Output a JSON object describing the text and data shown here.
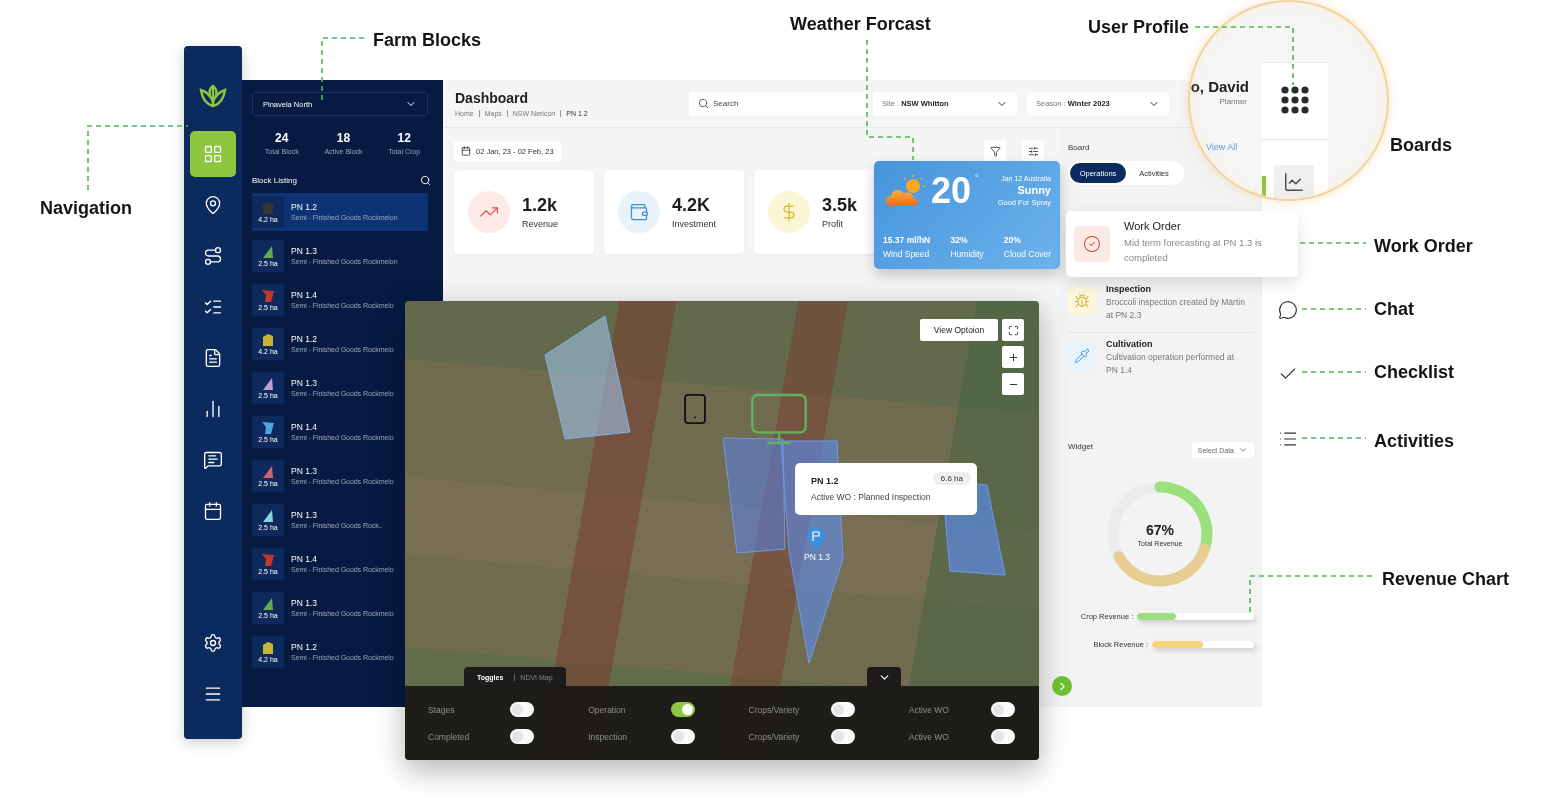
{
  "callouts": [
    {
      "label": "Farm Blocks"
    },
    {
      "label": "Weather Forcast"
    },
    {
      "label": "User Profile"
    },
    {
      "label": "Navigation"
    },
    {
      "label": "Boards"
    },
    {
      "label": "Work Order"
    },
    {
      "label": "Chat"
    },
    {
      "label": "Checklist"
    },
    {
      "label": "Activities"
    },
    {
      "label": "Revenue Chart"
    }
  ],
  "nav": {
    "items": [
      {
        "selected": true
      },
      {
        "selected": false
      },
      {
        "selected": false
      },
      {
        "selected": false
      },
      {
        "selected": false
      },
      {
        "selected": false
      },
      {
        "selected": false
      },
      {
        "selected": false
      }
    ]
  },
  "blocks": {
    "farm": "Pinavela North",
    "stats": [
      {
        "value": "24",
        "label": "Total Block"
      },
      {
        "value": "18",
        "label": "Active Block"
      },
      {
        "value": "12",
        "label": "Total Crop"
      }
    ],
    "title": "Block Listing",
    "items": [
      {
        "name": "PN 1.2",
        "description": "Semi - Finished Goods Rockmelon",
        "area": "4.2 ha",
        "kind": "house",
        "color": "#3a3535",
        "selected": true
      },
      {
        "name": "PN 1.3",
        "description": "Semi - Finished Goods Rockmelon",
        "area": "2.5 ha",
        "kind": "triangle",
        "color": "#6aa84f",
        "selected": false
      },
      {
        "name": "PN 1.4",
        "description": "Semi - Finished Goods Rockmelo",
        "area": "2.5 ha",
        "kind": "slant",
        "color": "#c0392b",
        "selected": false
      },
      {
        "name": "PN 1.2",
        "description": "Semi - Finished Goods Rockmelo",
        "area": "4.2 ha",
        "kind": "house",
        "color": "#c9b43a",
        "selected": false
      },
      {
        "name": "PN 1.3",
        "description": "Semi - Finished Goods Rockmelo",
        "area": "2.5 ha",
        "kind": "triangle",
        "color": "#c79bd4",
        "selected": false
      },
      {
        "name": "PN 1.4",
        "description": "Semi - Finished Goods Rockmelo",
        "area": "2.5 ha",
        "kind": "slant",
        "color": "#4aa3df",
        "selected": false
      },
      {
        "name": "PN 1.3",
        "description": "Semi - Finished Goods Rockmelo",
        "area": "2.5 ha",
        "kind": "triangle",
        "color": "#d0636f",
        "selected": false
      },
      {
        "name": "PN 1.3",
        "description": "Semi - Finished Goods Rock..",
        "area": "2.5 ha",
        "kind": "triangle",
        "color": "#8fd0e0",
        "selected": false
      },
      {
        "name": "PN 1.4",
        "description": "Semi - Finished Goods Rockmelo",
        "area": "2.5 ha",
        "kind": "slant",
        "color": "#c0392b",
        "selected": false
      },
      {
        "name": "PN 1.3",
        "description": "Semi - Finished Goods Rockmelo",
        "area": "2.5 ha",
        "kind": "triangle",
        "color": "#6aa84f",
        "selected": false
      },
      {
        "name": "PN 1.2",
        "description": "Semi - Finished Goods Rockmelo",
        "area": "4.2 ha",
        "kind": "house",
        "color": "#c9b43a",
        "selected": false
      }
    ]
  },
  "header": {
    "title": "Dashboard",
    "breadcrumb": [
      "Home",
      "Maps",
      "NSW Nericon",
      "PN 1.2"
    ],
    "search": {
      "placeholder": "Search"
    },
    "site": "Site : **NSW Whitton**",
    "season": "Season : **Winter 2023**"
  },
  "date_range": "02 Jan, 23 - 02 Feb, 23",
  "stats": [
    {
      "value": "1.2k",
      "label": "Revenue"
    },
    {
      "value": "4.2K",
      "label": "Investment"
    },
    {
      "value": "3.5k",
      "label": "Profit"
    }
  ],
  "weather": {
    "temperature": "20",
    "unit": "°",
    "date": "Jan 12 Australia",
    "condition": "Sunny",
    "advice": "Good For Spray",
    "metrics": [
      {
        "value": "15.37 ml/hN",
        "label": "Wind Speed"
      },
      {
        "value": "32%",
        "label": "Humidity"
      },
      {
        "value": "20%",
        "label": "Cloud Cover"
      }
    ]
  },
  "profile": {
    "name": "o, David",
    "role": "Planner",
    "link": "View All"
  },
  "board": {
    "title": "Board",
    "tabs": [
      {
        "label": "Operations",
        "selected": true
      },
      {
        "label": "Activities",
        "selected": false
      }
    ],
    "items": [
      {
        "title": "Inspection",
        "text": "Broccoli inspection created by Martin at PN 2.3"
      },
      {
        "title": "Cultivation",
        "text": "Cultivation operation performed at PN 1.4"
      }
    ]
  },
  "work_order": {
    "title": "Work Order",
    "text": "Mid term forecasting at PN 1.3 is completed"
  },
  "widget": {
    "title": "Widget",
    "select": "Select Data",
    "donut": {
      "value": "67%",
      "label": "Total Revenue"
    },
    "bars": [
      {
        "label": "Crop Revenue :",
        "level": 0.33,
        "color": "#9be07e"
      },
      {
        "label": "Block Revenue :",
        "level": 0.5,
        "color": "#f5d37a"
      }
    ]
  },
  "map": {
    "view_button": "View Optoion",
    "popup": {
      "title": "PN 1.2",
      "area": "6.6 ha",
      "detail": "Active WO : Planned Inspection"
    },
    "pin_label": "PN 1.3",
    "tabs": [
      {
        "label": "Toggles",
        "selected": true
      },
      {
        "label": "NDVI Map",
        "selected": false
      }
    ],
    "toggles": [
      {
        "label": "Stages",
        "on": false
      },
      {
        "label": "Operation",
        "on": true
      },
      {
        "label": "Crops/Variety",
        "on": false
      },
      {
        "label": "Active WO",
        "on": false
      },
      {
        "label": "Completed",
        "on": false
      },
      {
        "label": "Inspection",
        "on": false
      },
      {
        "label": "Crops/Variety",
        "on": false
      },
      {
        "label": "Active WO",
        "on": false
      }
    ]
  }
}
